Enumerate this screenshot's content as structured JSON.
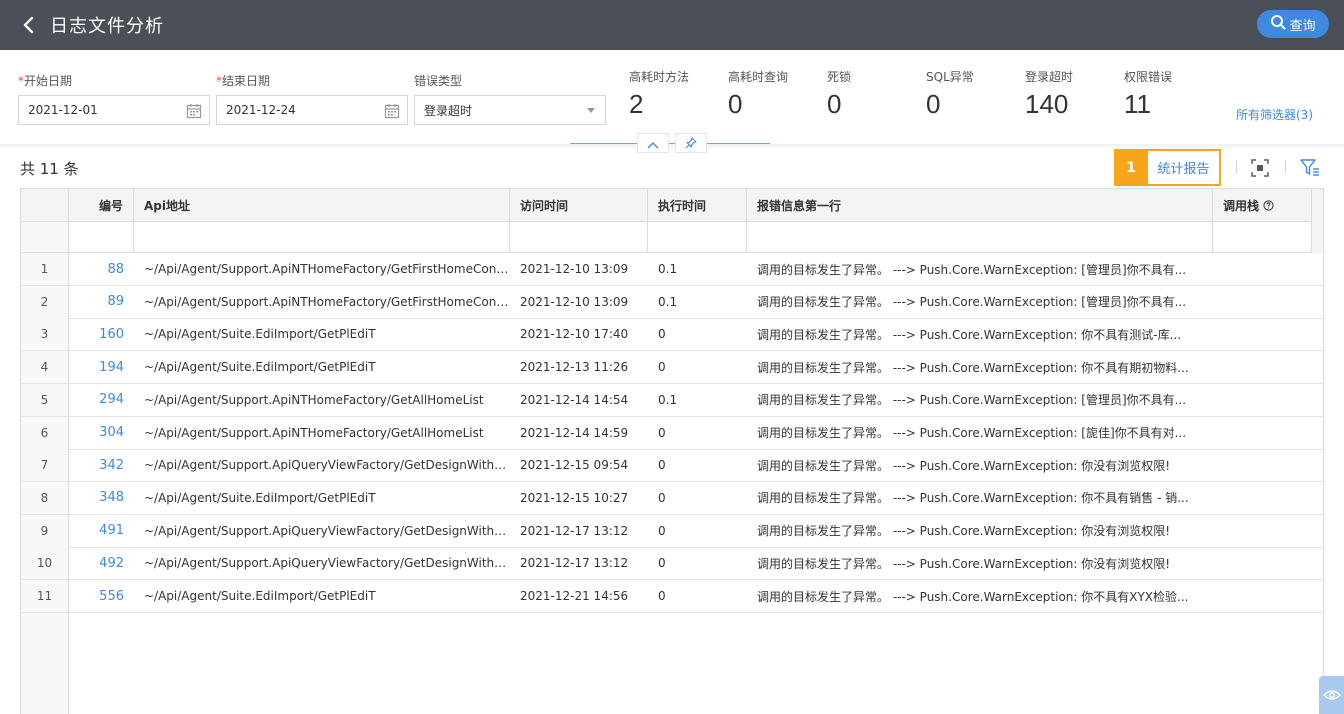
{
  "header": {
    "title": "日志文件分析",
    "query_label": "查询"
  },
  "filters": {
    "start_date": {
      "label": "开始日期",
      "required_mark": "*",
      "value": "2021-12-01"
    },
    "end_date": {
      "label": "结束日期",
      "required_mark": "*",
      "value": "2021-12-24"
    },
    "error_type": {
      "label": "错误类型",
      "value": "登录超时"
    }
  },
  "stats": [
    {
      "label": "高耗时方法",
      "value": "2"
    },
    {
      "label": "高耗时查询",
      "value": "0"
    },
    {
      "label": "死锁",
      "value": "0"
    },
    {
      "label": "SQL异常",
      "value": "0"
    },
    {
      "label": "登录超时",
      "value": "140"
    },
    {
      "label": "权限错误",
      "value": "11"
    }
  ],
  "all_filters_label": "所有筛选器(3)",
  "toolbar": {
    "count_text": "共 11 条",
    "badge": "1",
    "report_label": "统计报告"
  },
  "table": {
    "headers": [
      "编号",
      "Api地址",
      "访问时间",
      "执行时间",
      "报错信息第一行",
      "调用栈"
    ],
    "rows": [
      {
        "n": "1",
        "id": "88",
        "api": "~/Api/Agent/Support.ApiNTHomeFactory/GetFirstHomeConfig",
        "time": "2021-12-10 13:09",
        "exec": "0.1",
        "msg": "调用的目标发生了异常。 ---> Push.Core.WarnException: [管理员]你不具有..."
      },
      {
        "n": "2",
        "id": "89",
        "api": "~/Api/Agent/Support.ApiNTHomeFactory/GetFirstHomeConfig",
        "time": "2021-12-10 13:09",
        "exec": "0.1",
        "msg": "调用的目标发生了异常。 ---> Push.Core.WarnException: [管理员]你不具有..."
      },
      {
        "n": "3",
        "id": "160",
        "api": "~/Api/Agent/Suite.EdiImport/GetPlEdiT",
        "time": "2021-12-10 17:40",
        "exec": "0",
        "msg": "调用的目标发生了异常。 ---> Push.Core.WarnException: 你不具有测试-库..."
      },
      {
        "n": "4",
        "id": "194",
        "api": "~/Api/Agent/Suite.EdiImport/GetPlEdiT",
        "time": "2021-12-13 11:26",
        "exec": "0",
        "msg": "调用的目标发生了异常。 ---> Push.Core.WarnException: 你不具有期初物料..."
      },
      {
        "n": "5",
        "id": "294",
        "api": "~/Api/Agent/Support.ApiNTHomeFactory/GetAllHomeList",
        "time": "2021-12-14 14:54",
        "exec": "0.1",
        "msg": "调用的目标发生了异常。 ---> Push.Core.WarnException: [管理员]你不具有..."
      },
      {
        "n": "6",
        "id": "304",
        "api": "~/Api/Agent/Support.ApiNTHomeFactory/GetAllHomeList",
        "time": "2021-12-14 14:59",
        "exec": "0",
        "msg": "调用的目标发生了异常。 ---> Push.Core.WarnException: [旎佳]你不具有对..."
      },
      {
        "n": "7",
        "id": "342",
        "api": "~/Api/Agent/Support.ApiQueryViewFactory/GetDesignWithP...",
        "time": "2021-12-15 09:54",
        "exec": "0",
        "msg": "调用的目标发生了异常。 ---> Push.Core.WarnException: 你没有浏览权限!"
      },
      {
        "n": "8",
        "id": "348",
        "api": "~/Api/Agent/Suite.EdiImport/GetPlEdiT",
        "time": "2021-12-15 10:27",
        "exec": "0",
        "msg": "调用的目标发生了异常。 ---> Push.Core.WarnException: 你不具有销售 - 销..."
      },
      {
        "n": "9",
        "id": "491",
        "api": "~/Api/Agent/Support.ApiQueryViewFactory/GetDesignWithP...",
        "time": "2021-12-17 13:12",
        "exec": "0",
        "msg": "调用的目标发生了异常。 ---> Push.Core.WarnException: 你没有浏览权限!"
      },
      {
        "n": "10",
        "id": "492",
        "api": "~/Api/Agent/Support.ApiQueryViewFactory/GetDesignWithP...",
        "time": "2021-12-17 13:12",
        "exec": "0",
        "msg": "调用的目标发生了异常。 ---> Push.Core.WarnException: 你没有浏览权限!"
      },
      {
        "n": "11",
        "id": "556",
        "api": "~/Api/Agent/Suite.EdiImport/GetPlEdiT",
        "time": "2021-12-21 14:56",
        "exec": "0",
        "msg": "调用的目标发生了异常。 ---> Push.Core.WarnException: 你不具有XYX检验..."
      }
    ]
  },
  "colors": {
    "header_bg": "#4b4f57",
    "accent": "#3f8ae0",
    "highlight": "#f7a51a"
  },
  "icons": [
    "back-arrow-icon",
    "search-icon",
    "calendar-icon",
    "dropdown-caret-icon",
    "chevron-up-icon",
    "pin-icon",
    "fullscreen-icon",
    "filter-settings-icon",
    "help-circle-icon",
    "eye-icon"
  ]
}
